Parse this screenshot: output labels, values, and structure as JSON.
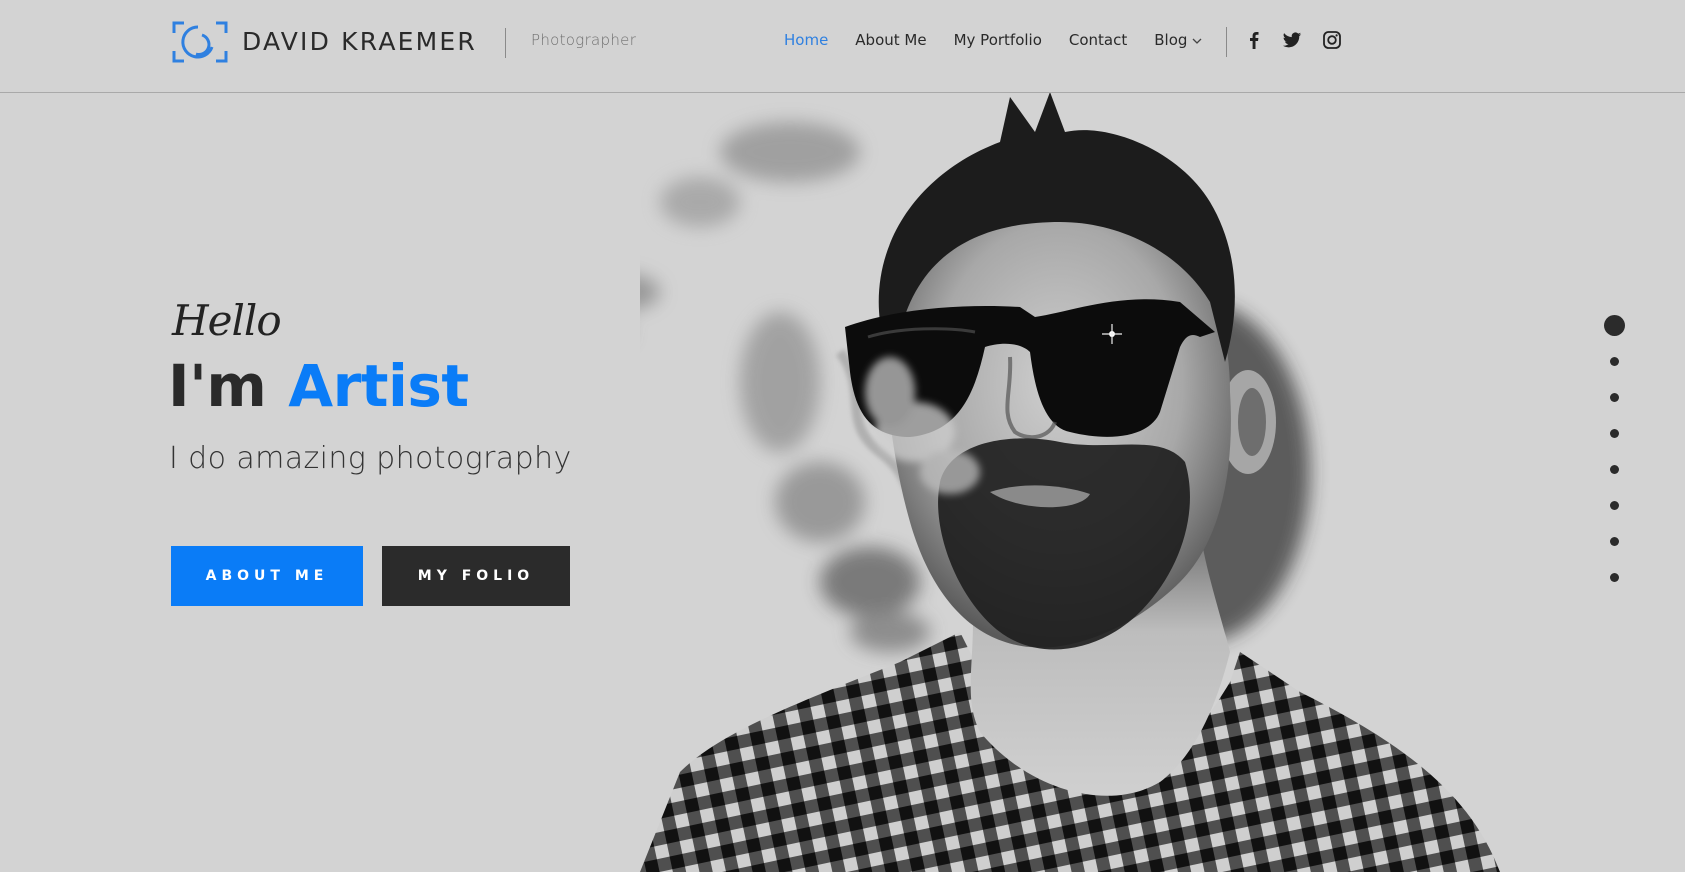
{
  "header": {
    "brand": "DAVID KRAEMER",
    "tagline": "Photographer",
    "logo_icon": "camera-focus-icon",
    "nav": [
      {
        "label": "Home",
        "active": true
      },
      {
        "label": "About Me",
        "active": false
      },
      {
        "label": "My Portfolio",
        "active": false
      },
      {
        "label": "Contact",
        "active": false
      },
      {
        "label": "Blog",
        "active": false,
        "has_dropdown": true,
        "dropdown_icon": "chevron-down-icon"
      }
    ],
    "social": [
      {
        "name": "facebook",
        "icon": "facebook-icon"
      },
      {
        "name": "twitter",
        "icon": "twitter-icon"
      },
      {
        "name": "instagram",
        "icon": "instagram-icon"
      }
    ]
  },
  "hero": {
    "greeting": "Hello",
    "headline_prefix": "I'm",
    "headline_accent": "Artist",
    "subtitle": "I do amazing photography",
    "buttons": {
      "primary": "ABOUT ME",
      "secondary": "MY FOLIO"
    },
    "image": "black-and-white portrait of bearded man in sunglasses exhaling smoke, plaid shirt"
  },
  "slider": {
    "total_slides": 8,
    "active_index": 0
  },
  "colors": {
    "accent": "#0a7cf7",
    "nav_active": "#2f80e0",
    "dark": "#2b2b2b",
    "background": "#d3d3d3"
  },
  "chevron_glyph": "⌵"
}
